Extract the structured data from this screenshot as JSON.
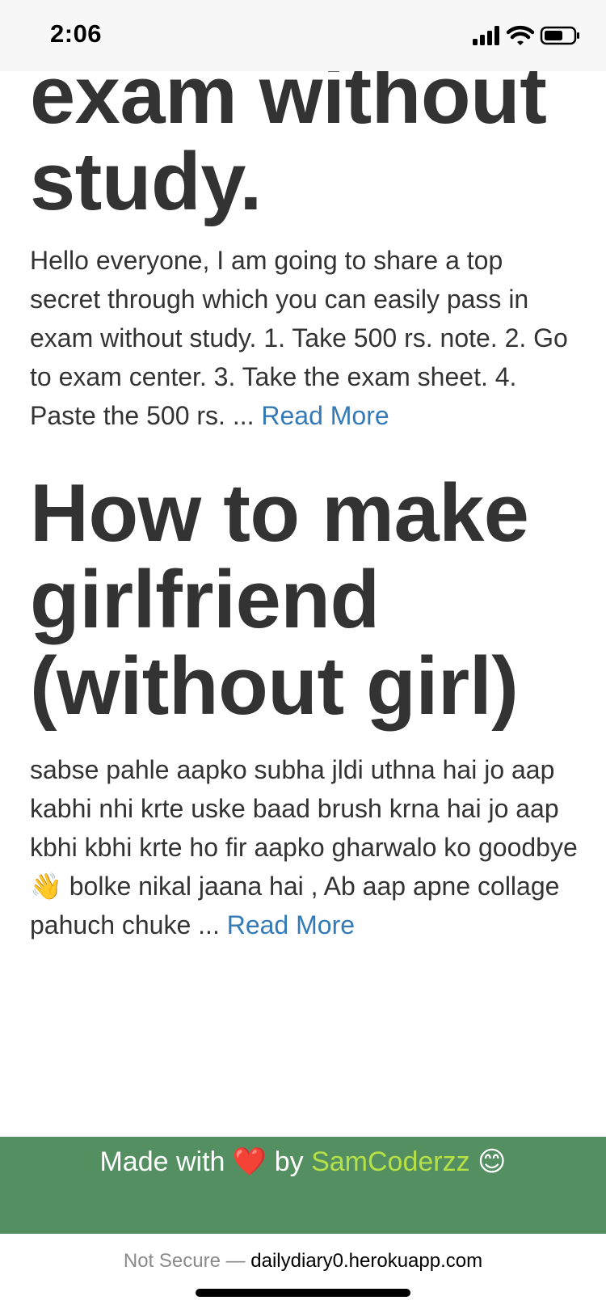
{
  "status_bar": {
    "time": "2:06"
  },
  "posts": [
    {
      "title": "exam without study.",
      "excerpt": "Hello everyone, I am going to share a top secret through which you can easily pass in exam without study. 1. Take 500 rs. note. 2. Go to exam center. 3. Take the exam sheet. 4. Paste the 500 rs. ...",
      "read_more": "Read More"
    },
    {
      "title": "How to make girlfriend (without girl)",
      "excerpt_part1": "sabse pahle aapko subha jldi uthna hai jo aap kabhi nhi krte uske baad brush krna hai jo aap kbhi kbhi krte ho fir aapko gharwalo ko goodbye",
      "excerpt_emoji": "👋",
      "excerpt_part2": "bolke nikal jaana hai , Ab aap apne collage pahuch chuke ...",
      "read_more": "Read More"
    }
  ],
  "footer": {
    "made_with": "Made with",
    "heart": "❤️",
    "by": "by",
    "author": "SamCoderzz",
    "smile": "😊",
    "colors": {
      "background": "#548f62",
      "link": "#b5e046"
    }
  },
  "browser": {
    "not_secure": "Not Secure —",
    "domain": "dailydiary0.herokuapp.com"
  },
  "colors": {
    "link": "#337ab7",
    "text": "#333333"
  },
  "icons": [
    "cellular-signal-icon",
    "wifi-icon",
    "battery-icon"
  ]
}
